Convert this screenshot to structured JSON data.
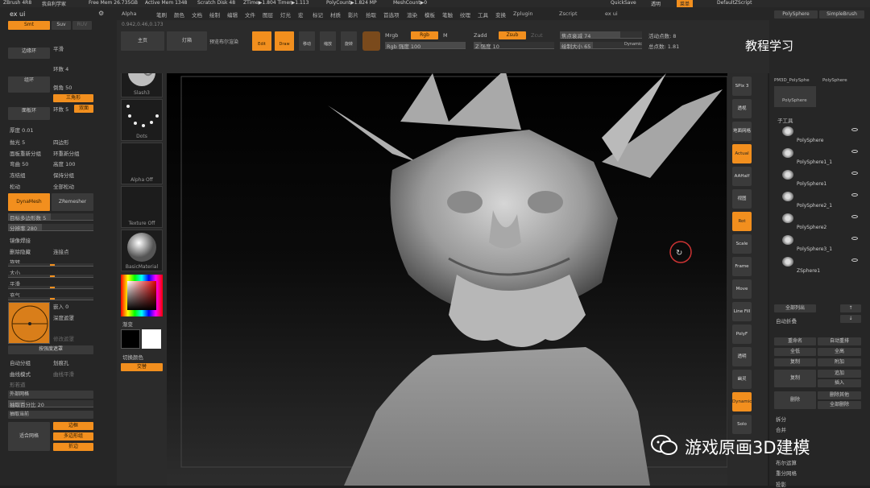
{
  "topbar": {
    "app": "ZBrush 4R8",
    "project": "我自利学家",
    "free_mem": "Free Mem 26.735GB",
    "active_mem": "Active Mem 1348",
    "scratch": "Scratch Disk 48",
    "ztime": "ZTime▶1.804 Timer▶1.113",
    "polycount": "PolyCount▶1.824 MP",
    "meshcount": "MeshCount▶0",
    "quicksave": "QuickSave",
    "transp": "透明",
    "transp_val": "0",
    "menu_btn": "菜单",
    "script": "DefaultZScript"
  },
  "left": {
    "title": "ex ui",
    "smt": "Smt",
    "suv": "Suv",
    "reuv": "RUV",
    "items": [
      "平滑",
      "边缘环",
      "环数 4",
      "相斜",
      "组环",
      "倒角 50",
      "三角形",
      "面板环",
      "环数 5",
      "双面",
      "厚度 0.01",
      "组数",
      "四边形",
      "抛光 5",
      "面板重新分组",
      "环重新分组",
      "弯曲 50",
      "高度 100",
      "冻结组",
      "保持分组",
      "松动",
      "全部松动"
    ],
    "dynamesh": "DynaMesh",
    "zremesher": "ZRemesher",
    "target_poly": "目标多边形数 5",
    "resolution": "分辨率 280",
    "mirror_weld": "镜像焊接",
    "del_hidden": "删除隐藏",
    "close_holes": "连接点",
    "rotate": "旋转",
    "size": "大小",
    "smooth": "平滑",
    "inflate": "充气",
    "embed": "嵌入 0",
    "depth_mask": "深度遮罩",
    "modify": "修改遮罩",
    "mask_depth": "按强度遮罩",
    "auto_group": "自动分组",
    "split": "划痕孔",
    "curve_mode": "曲线模式",
    "weight": "曲线平滑",
    "plane": "形若道",
    "extract": "外部网格",
    "thick_label": "抽取百分比 20",
    "extract_btn": "抽取当前",
    "fill": "适合网格",
    "fill_opts": [
      "边框",
      "多边形组",
      "折边"
    ]
  },
  "mid": {
    "brush": "Slash3",
    "stroke": "Dots",
    "alpha": "Alpha Off",
    "texture": "Texture Off",
    "material": "BasicMaterial",
    "gradient": "渐变",
    "switch_color": "切换颜色",
    "swap": "交替"
  },
  "toolbar": {
    "home": "主页",
    "lightbox": "灯箱",
    "preview": "预览布尔渲染",
    "edit": "Edit",
    "draw": "Draw",
    "move": "移动",
    "scale": "缩放",
    "rotate": "旋转",
    "coords": "0.942,0.46,0.173",
    "mrgb": "Mrgb",
    "rgb": "Rgb",
    "m": "M",
    "rgb_intensity": "Rgb 强度 100",
    "zadd": "Zadd",
    "zsub": "Zsub",
    "zcut": "Zcut",
    "z_intensity": "Z 强度 10",
    "focal": "焦点衰减 74",
    "draw_size": "绘制大小 65",
    "dynamic": "Dynamic",
    "active_pts": "活动点数: 8",
    "total_pts": "总点数: 1.81"
  },
  "menus": [
    "Alpha",
    "笔刷",
    "颜色",
    "文档",
    "绘制",
    "编辑",
    "文件",
    "图层",
    "灯光",
    "宏",
    "标记",
    "材质",
    "影片",
    "拾取",
    "首选项",
    "渲染",
    "模板",
    "笔触",
    "纹理",
    "工具",
    "变换",
    "Zplugin",
    "Zscript",
    "ex ui"
  ],
  "vtools": [
    "SPix 3",
    "透视",
    "地面网格",
    "Actual",
    "AAHalf",
    "视图",
    "Rot",
    "Scale",
    "Frame",
    "Move",
    "Line Fill",
    "PolyF",
    "透明",
    "幽灵",
    "Dynamic",
    "Solo"
  ],
  "right": {
    "tabs": [
      "PolySphere",
      "SimpleBrush"
    ],
    "tool1": "PM3D_PolySphe",
    "tool2": "PolySphere",
    "tool3": "PolySphere",
    "subtool_title": "子工具",
    "subtools": [
      "PolySphere",
      "PolySphere1_1",
      "PolySphere1",
      "PolySphere2_1",
      "PolySphere2",
      "PolySphere3_1",
      "ZSphere1"
    ],
    "list_all": "全部列出",
    "auto_collapse": "自动折叠",
    "rename": "重命名",
    "auto_reorder": "自动重排",
    "all_low": "全低",
    "all_high": "全高",
    "copy": "复制",
    "paste": "附加",
    "duplicate": "复制",
    "append": "追加",
    "insert": "插入",
    "delete": "删除",
    "del_other": "删除其他",
    "del_all": "全部删除",
    "split": "拆分",
    "merge": "合并",
    "boolean": "布尔运算",
    "remesh": "重分网格",
    "project": "投影"
  },
  "overlay": {
    "title": "教程学习",
    "watermark": "游戏原画3D建模"
  },
  "colors": {
    "accent": "#f28f1e"
  }
}
